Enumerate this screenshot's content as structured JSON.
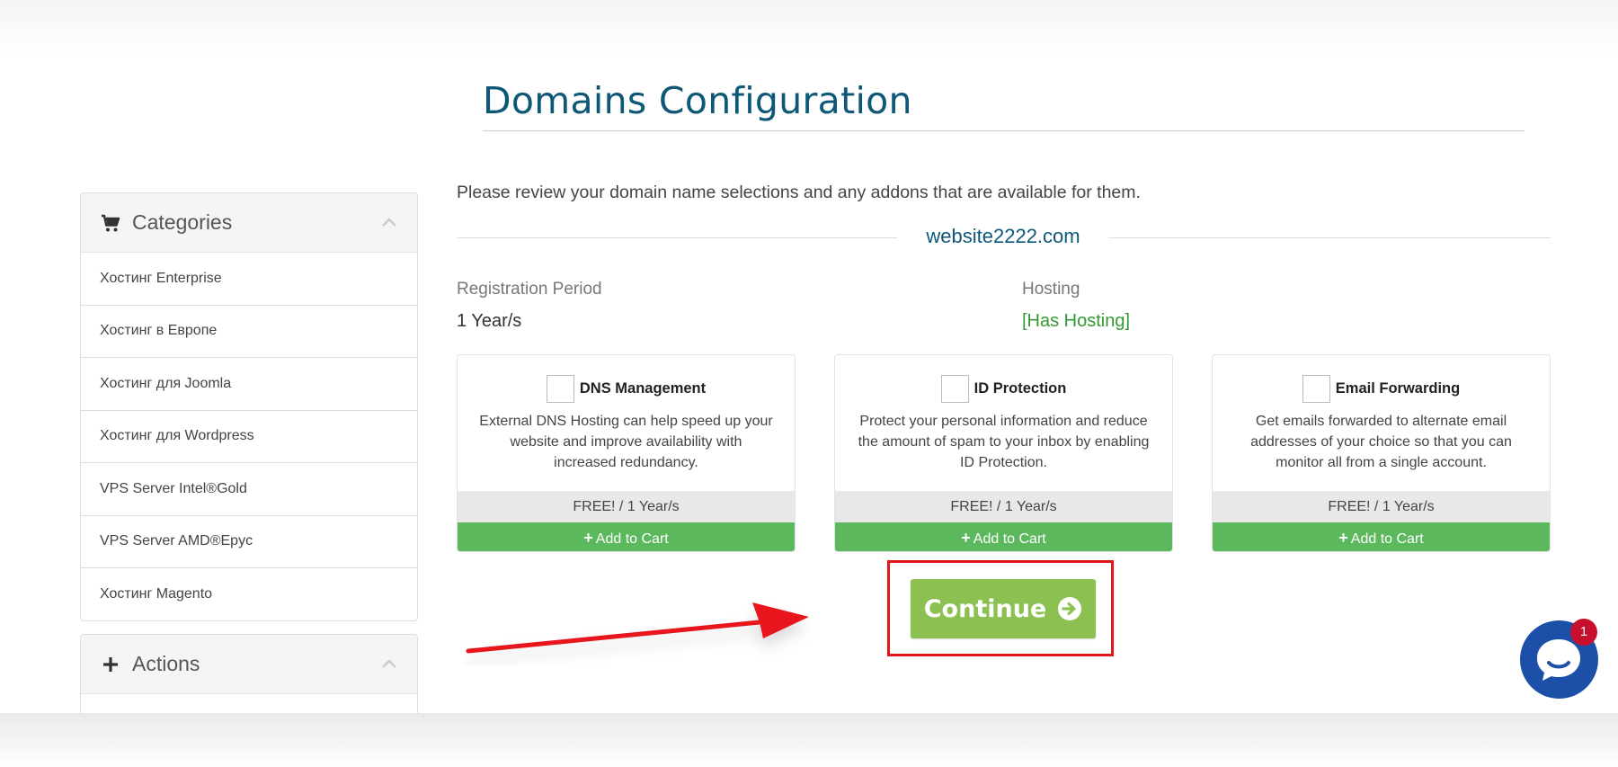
{
  "page": {
    "title": "Domains Configuration"
  },
  "sidebar": {
    "categories": {
      "title": "Categories",
      "icon": "shopping-cart-icon",
      "items": [
        {
          "label": "Хостинг Enterprise"
        },
        {
          "label": "Хостинг в Европе"
        },
        {
          "label": "Хостинг для Joomla"
        },
        {
          "label": "Хостинг для Wordpress"
        },
        {
          "label": "VPS Server Intel®Gold"
        },
        {
          "label": "VPS Server AMD®Epyc"
        },
        {
          "label": "Хостинг Magento"
        }
      ]
    },
    "actions": {
      "title": "Actions",
      "icon": "plus-icon"
    }
  },
  "main": {
    "intro": "Please review your domain name selections and any addons that are available for them.",
    "domain": "website2222.com",
    "registration": {
      "label": "Registration Period",
      "value": "1 Year/s"
    },
    "hosting": {
      "label": "Hosting",
      "value": "[Has Hosting]"
    },
    "addons": [
      {
        "name": "DNS Management",
        "description": "External DNS Hosting can help speed up your website and improve availability with increased redundancy.",
        "price": "FREE! / 1 Year/s",
        "cart_label": "Add to Cart"
      },
      {
        "name": "ID Protection",
        "description": "Protect your personal information and reduce the amount of spam to your inbox by enabling ID Protection.",
        "price": "FREE! / 1 Year/s",
        "cart_label": "Add to Cart"
      },
      {
        "name": "Email Forwarding",
        "description": "Get emails forwarded to alternate email addresses of your choice so that you can monitor all from a single account.",
        "price": "FREE! / 1 Year/s",
        "cart_label": "Add to Cart"
      }
    ],
    "continue_label": "Continue"
  },
  "chat": {
    "badge_count": "1"
  },
  "colors": {
    "title": "#0d5777",
    "hosting_green": "#339933",
    "cart_green": "#5cb85c",
    "continue_green": "#8cc152",
    "highlight_red": "#e0161b",
    "chat_blue": "#1b4fa8"
  }
}
